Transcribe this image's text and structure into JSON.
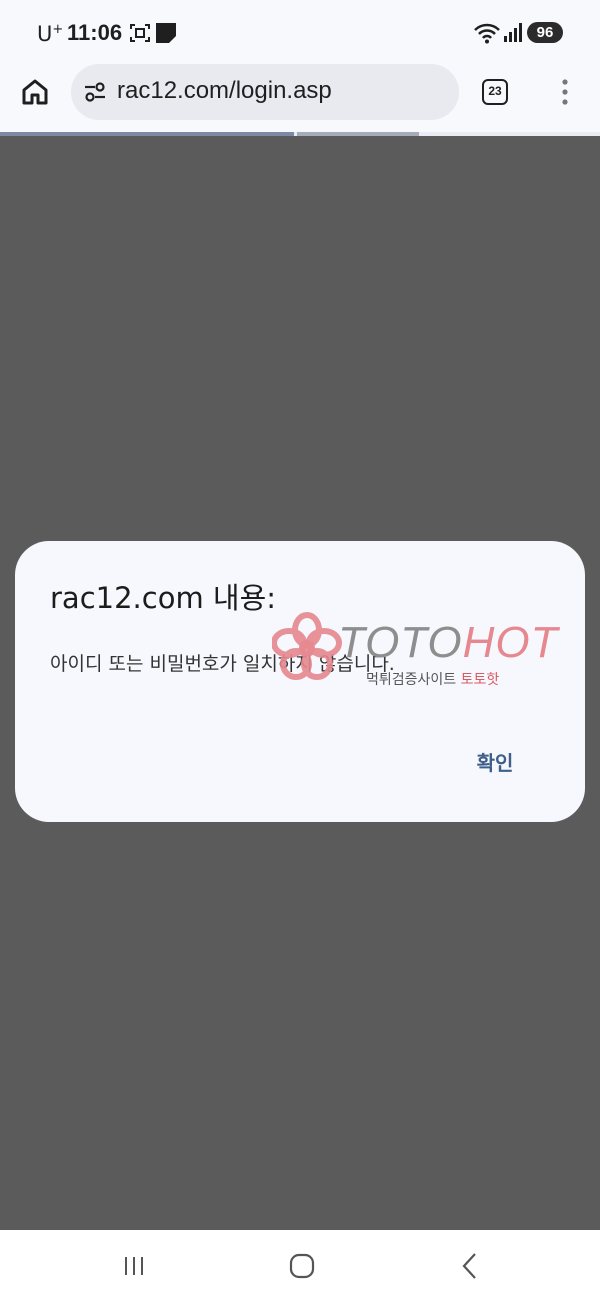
{
  "status_bar": {
    "carrier": "U",
    "carrier_sup": "+",
    "time": "11:06",
    "battery": "96",
    "icons": [
      "screenshot-icon",
      "note-icon",
      "wifi-icon",
      "signal-icon",
      "battery-icon"
    ]
  },
  "browser": {
    "url": "rac12.com/login.asp",
    "tab_count": "23",
    "icons": [
      "home-icon",
      "site-info-icon",
      "tabs-icon",
      "more-vert-icon"
    ],
    "load_progress": 0.49
  },
  "dialog": {
    "title": "rac12.com 내용:",
    "message": "아이디 또는 비밀번호가 일치하지 않습니다.",
    "ok_label": "확인"
  },
  "watermark": {
    "brand_part1": "TOTO",
    "brand_part2": "HOT",
    "tagline": "먹튀검증사이트",
    "tagline_highlight": "토토핫"
  },
  "nav_bar": {
    "icons": [
      "recent-apps-icon",
      "home-nav-icon",
      "back-icon"
    ]
  },
  "colors": {
    "overlay": "#5b5b5b",
    "dialog_bg": "#f7f8fd",
    "accent": "#3e5f8a",
    "watermark_pink": "#e6888f"
  }
}
